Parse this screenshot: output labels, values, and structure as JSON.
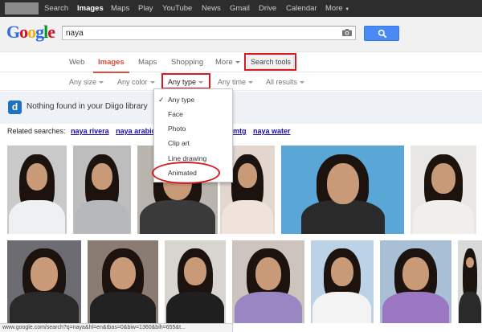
{
  "topbar": {
    "items": [
      {
        "label": "Search",
        "active": false
      },
      {
        "label": "Images",
        "active": true
      },
      {
        "label": "Maps",
        "active": false
      },
      {
        "label": "Play",
        "active": false
      },
      {
        "label": "YouTube",
        "active": false
      },
      {
        "label": "News",
        "active": false
      },
      {
        "label": "Gmail",
        "active": false
      },
      {
        "label": "Drive",
        "active": false
      },
      {
        "label": "Calendar",
        "active": false
      },
      {
        "label": "More",
        "active": false
      }
    ]
  },
  "header": {
    "logo_letters": [
      {
        "ch": "G",
        "color": "#3369e8"
      },
      {
        "ch": "o",
        "color": "#d50f25"
      },
      {
        "ch": "o",
        "color": "#eeb211"
      },
      {
        "ch": "g",
        "color": "#3369e8"
      },
      {
        "ch": "l",
        "color": "#009925"
      },
      {
        "ch": "e",
        "color": "#d50f25"
      }
    ],
    "search_value": "naya",
    "camera_icon": "camera-icon",
    "search_button_icon": "magnifier-icon"
  },
  "tabs": {
    "items": [
      {
        "label": "Web"
      },
      {
        "label": "Images"
      },
      {
        "label": "Maps"
      },
      {
        "label": "Shopping"
      },
      {
        "label": "More"
      }
    ],
    "search_tools": "Search tools"
  },
  "filters": {
    "items": [
      {
        "label": "Any size"
      },
      {
        "label": "Any color"
      },
      {
        "label": "Any type"
      },
      {
        "label": "Any time"
      },
      {
        "label": "All results"
      }
    ]
  },
  "diigo": {
    "icon_letter": "d",
    "message": "Nothing found in your Diigo library"
  },
  "related": {
    "prefix": "Related searches:",
    "links": [
      "naya rivera",
      "naya arabic si",
      "mtg",
      "naya water"
    ]
  },
  "type_menu": {
    "items": [
      {
        "label": "Any type",
        "checked": true
      },
      {
        "label": "Face",
        "checked": false
      },
      {
        "label": "Photo",
        "checked": false
      },
      {
        "label": "Clip art",
        "checked": false
      },
      {
        "label": "Line drawing",
        "checked": false
      },
      {
        "label": "Animated",
        "checked": false
      }
    ],
    "check_glyph": "✓"
  },
  "status_bar": {
    "url": "www.google.com/search?q=naya&hl=en&tbas=0&biw=1360&bih=655&t..."
  },
  "colors": {
    "highlight_red": "#d71920",
    "active_tab": "#dd4b39",
    "link_blue": "#1a0dab",
    "button_blue": "#4a8af4"
  }
}
